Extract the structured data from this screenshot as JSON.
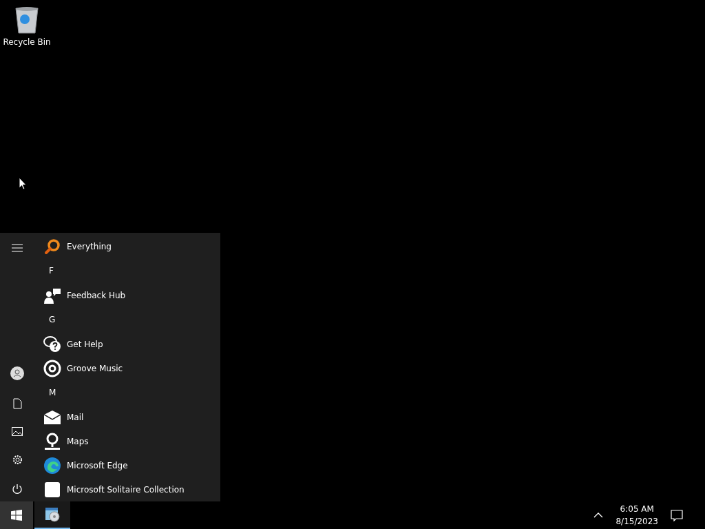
{
  "desktop": {
    "icons": [
      {
        "label": "Recycle Bin"
      }
    ]
  },
  "start_menu": {
    "items": [
      {
        "kind": "app",
        "label": "Everything"
      },
      {
        "kind": "header",
        "label": "F"
      },
      {
        "kind": "app",
        "label": "Feedback Hub"
      },
      {
        "kind": "header",
        "label": "G"
      },
      {
        "kind": "app",
        "label": "Get Help"
      },
      {
        "kind": "app",
        "label": "Groove Music"
      },
      {
        "kind": "header",
        "label": "M"
      },
      {
        "kind": "app",
        "label": "Mail"
      },
      {
        "kind": "app",
        "label": "Maps"
      },
      {
        "kind": "app",
        "label": "Microsoft Edge"
      },
      {
        "kind": "app",
        "label": "Microsoft Solitaire Collection"
      }
    ]
  },
  "taskbar": {
    "apps": [
      {
        "running": true
      }
    ],
    "time": "6:05 AM",
    "date": "8/15/2023"
  }
}
